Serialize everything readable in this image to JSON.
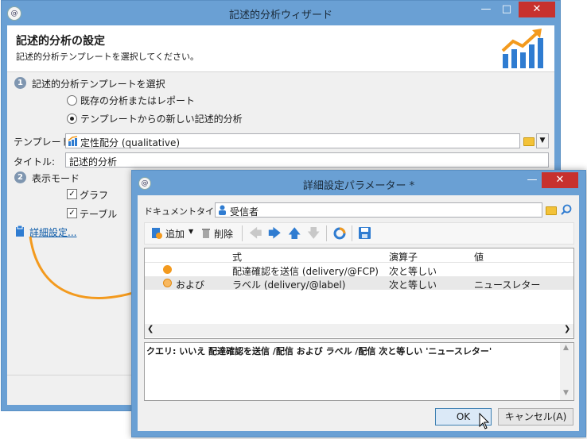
{
  "main": {
    "title": "記述的分析ウィザード",
    "app_icon": "@",
    "header": {
      "title": "記述的分析の設定",
      "subtitle": "記述的分析テンプレートを選択してください。"
    },
    "step1": {
      "number": "1",
      "label": "記述的分析テンプレートを選択",
      "option1": "既存の分析またはレポート",
      "option2": "テンプレートからの新しい記述的分析",
      "selected": "option2"
    },
    "template_label": "テンプレート:",
    "template_value": "定性配分 (qualitative)",
    "title_label": "タイトル:",
    "title_value": "記述的分析",
    "step2": {
      "number": "2",
      "label": "表示モード",
      "graph": "グラフ",
      "table": "テーブル"
    },
    "advanced_link": "詳細設定..."
  },
  "dialog": {
    "title": "詳細設定パラメーター *",
    "doc_type_label": "ドキュメントタイプ:",
    "doc_type_value": "受信者",
    "toolbar": {
      "add": "追加",
      "delete": "削除"
    },
    "columns": [
      "式",
      "演算子",
      "値"
    ],
    "rows": [
      {
        "prefix": "",
        "expr": "配達確認を送信 (delivery/@FCP)",
        "op": "次と等しい",
        "value": ""
      },
      {
        "prefix": "および",
        "expr": "ラベル (delivery/@label)",
        "op": "次と等しい",
        "value": "ニュースレター"
      }
    ],
    "query": "クエリ: いいえ 配達確認を送信 /配信 および ラベル /配信 次と等しい 'ニュースレター'",
    "ok": "OK",
    "cancel": "キャンセル(A)"
  },
  "colors": {
    "title_bar": "#6aa0d4",
    "close_button": "#c7312e",
    "accent_orange": "#f39a1e",
    "link": "#0b5aa8"
  }
}
